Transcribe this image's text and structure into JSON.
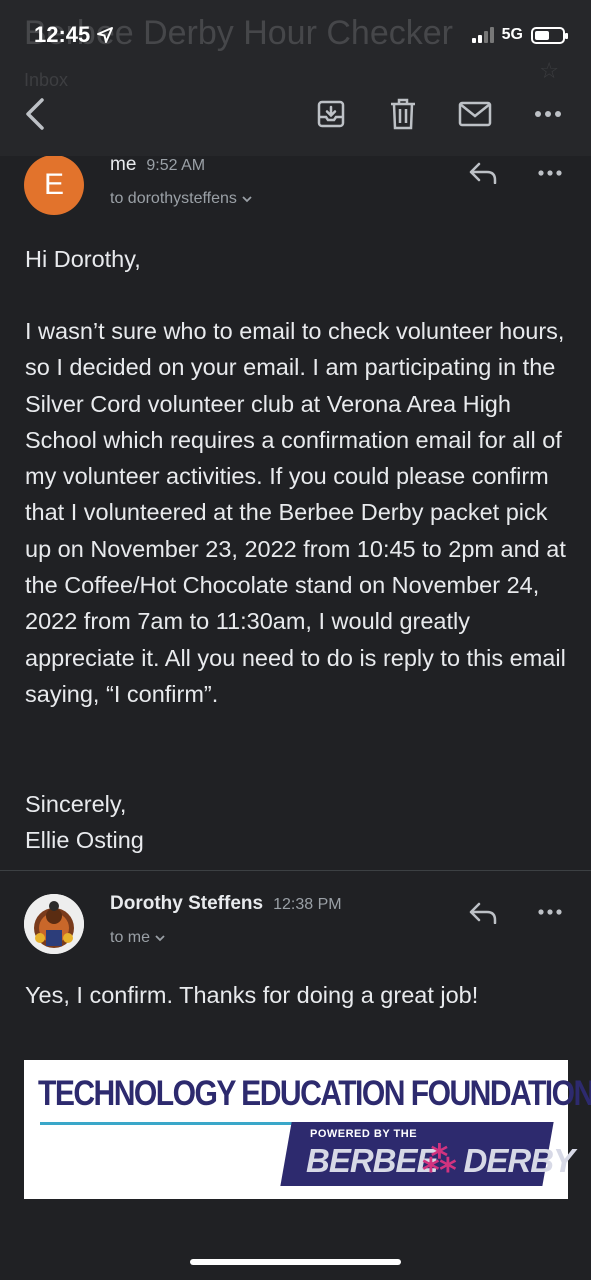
{
  "status_bar": {
    "time": "12:45",
    "network": "5G"
  },
  "header": {
    "subject_ghost": "Berbee Derby Hour Checker",
    "label_ghost": "Inbox"
  },
  "toolbar": {
    "back_icon": "chevron-left-icon",
    "archive_icon": "archive-icon",
    "delete_icon": "trash-icon",
    "mark_unread_icon": "mail-icon",
    "more_icon": "more-horizontal-icon"
  },
  "messages": [
    {
      "avatar_letter": "E",
      "sender": "me",
      "time": "9:52 AM",
      "to": "to dorothysteffens",
      "greeting": "Hi Dorothy,",
      "paragraph": "I wasn’t sure who to email to check volunteer hours, so I decided on your email. I am participating in the Silver Cord volunteer club at Verona Area High School which requires a confirmation email for all of my volunteer activities. If you could please confirm that I volunteered at the Berbee Derby packet pick up on November 23, 2022 from 10:45 to 2pm and at the Coffee/Hot Chocolate stand on November 24, 2022 from 7am to 11:30am, I would greatly appreciate it. All you need to do is reply to this email saying, “I confirm”.",
      "closing": "Sincerely,",
      "signature": "Ellie Osting"
    },
    {
      "sender": "Dorothy Steffens",
      "time": "12:38 PM",
      "to": "to me",
      "body": "Yes, I confirm. Thanks for doing a great job!"
    }
  ],
  "banner": {
    "title": "TECHNOLOGY EDUCATION FOUNDATION",
    "powered": "POWERED BY THE",
    "derby_left": "BERBEE",
    "derby_right": "DERBY"
  },
  "colors": {
    "background": "#202124",
    "avatar_orange": "#e2732c",
    "banner_navy": "#2d2a6e",
    "banner_pink": "#d1337f"
  }
}
